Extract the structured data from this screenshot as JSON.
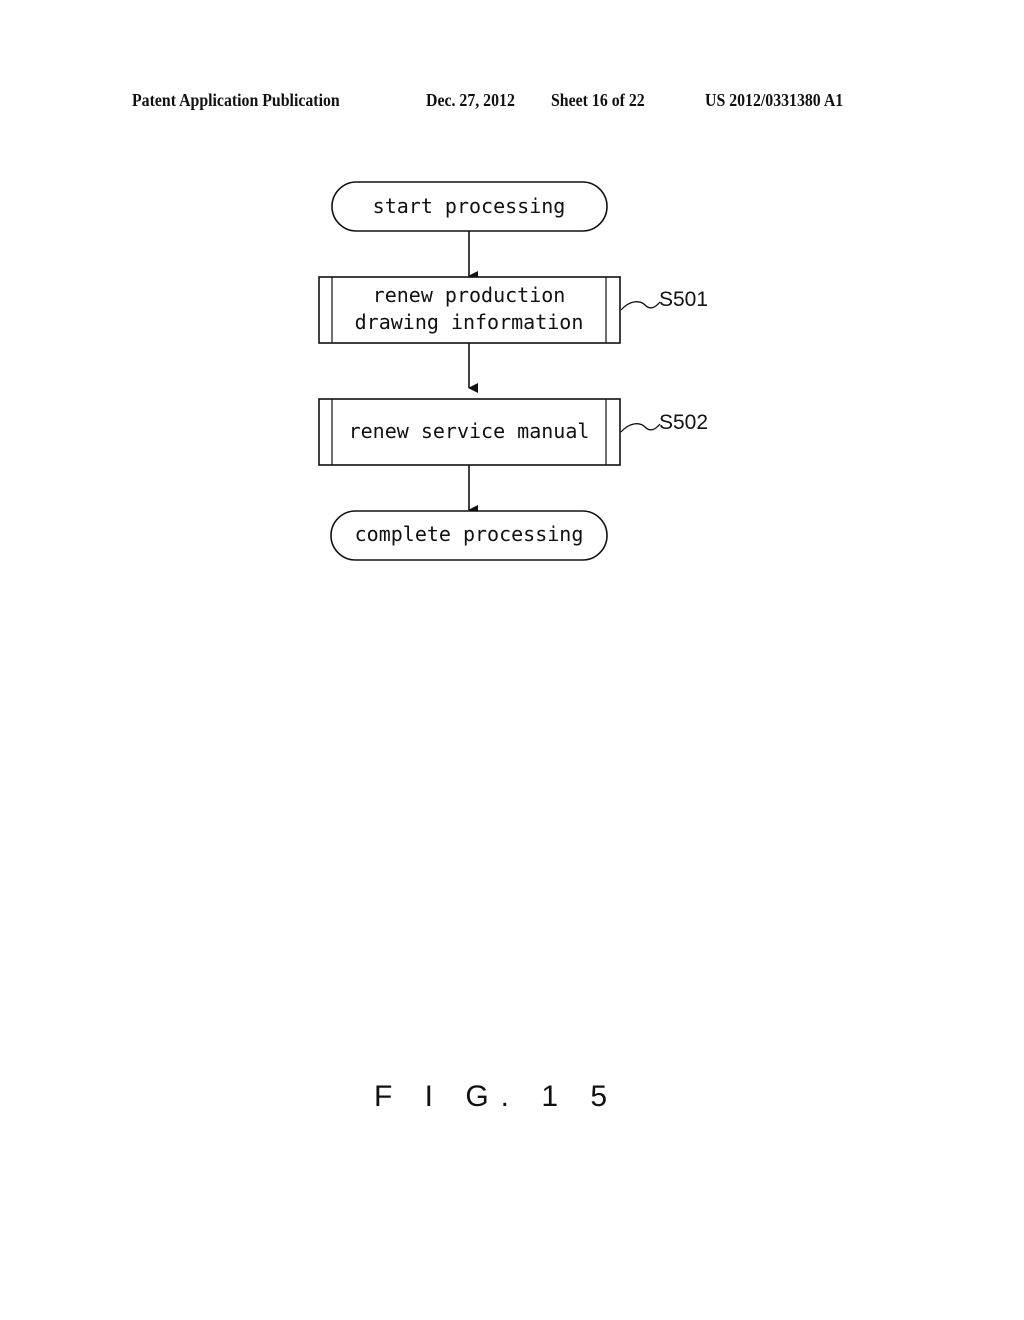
{
  "header": {
    "publication": "Patent Application Publication",
    "date": "Dec. 27, 2012",
    "sheet": "Sheet 16 of 22",
    "number": "US 2012/0331380 A1"
  },
  "flowchart": {
    "start": "start processing",
    "steps": [
      {
        "line1": "renew production",
        "line2": "drawing information",
        "label": "S501"
      },
      {
        "line1": "renew service manual",
        "label": "S502"
      }
    ],
    "end": "complete processing"
  },
  "figure_label": "F I G. 1 5"
}
